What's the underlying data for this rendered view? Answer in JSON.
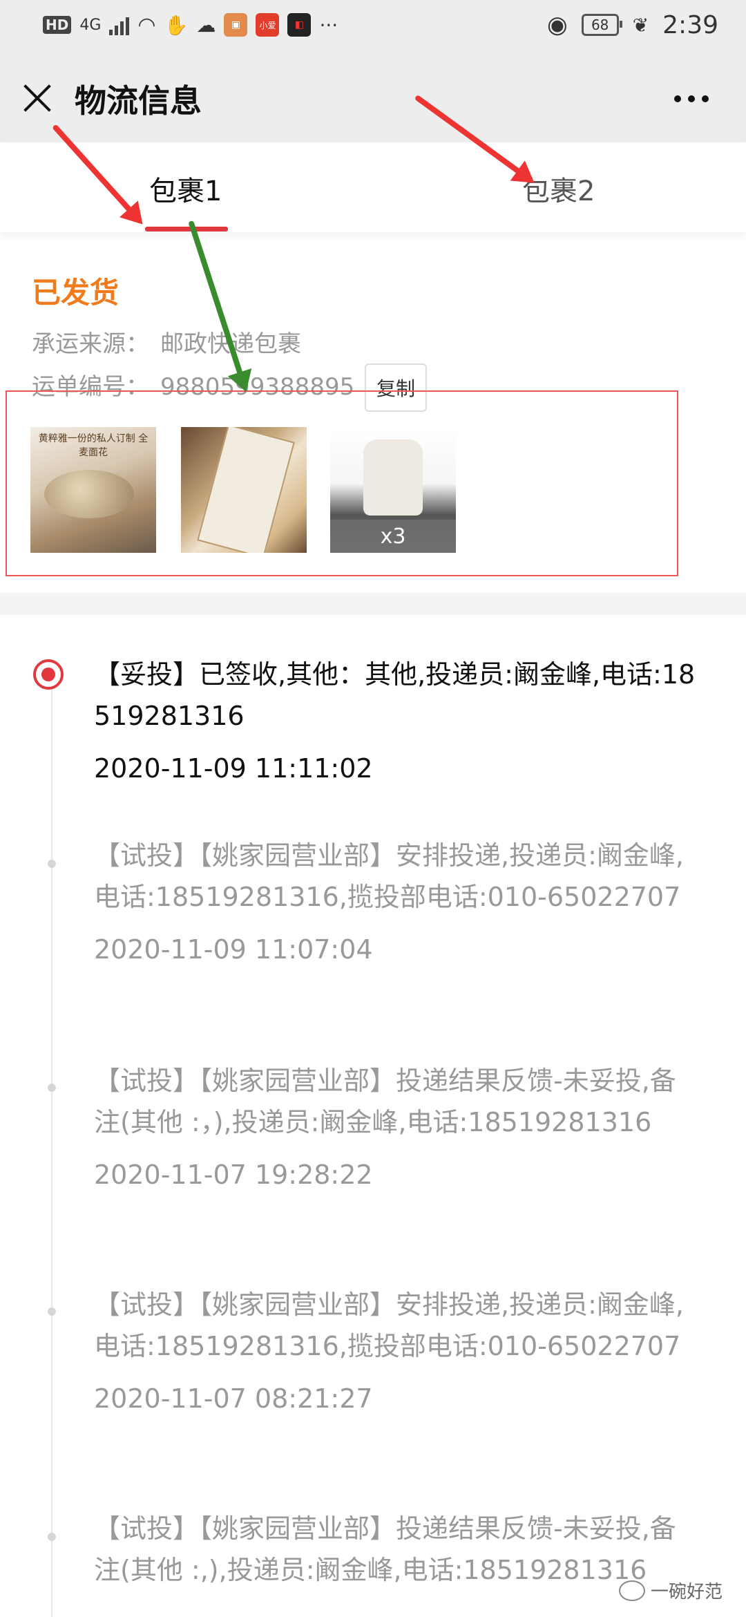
{
  "status_bar": {
    "hd": "HD",
    "network": "4G",
    "app_badge": "小爱",
    "more": "···",
    "battery": "68",
    "time": "2:39"
  },
  "header": {
    "title": "物流信息"
  },
  "tabs": [
    {
      "label": "包裹1",
      "active": true
    },
    {
      "label": "包裹2",
      "active": false
    }
  ],
  "shipment": {
    "status": "已发货",
    "carrier_label": "承运来源：",
    "carrier_value": "邮政快递包裹",
    "tracking_label": "运单编号：",
    "tracking_value": "9880599388895",
    "copy_label": "复制"
  },
  "products": [
    {
      "icon": "bread-product-image",
      "text": "黄粹雅一份的私人订制 全麦面花"
    },
    {
      "icon": "noodle-package-image"
    },
    {
      "icon": "flour-bag-image",
      "quantity": "x3"
    }
  ],
  "events": [
    {
      "desc": "【妥投】已签收,其他：其他,投递员:阚金峰,电话:18519281316",
      "time": "2020-11-09 11:11:02"
    },
    {
      "desc": "【试投】【姚家园营业部】安排投递,投递员:阚金峰,电话:18519281316,揽投部电话:010-65022707",
      "time": "2020-11-09 11:07:04"
    },
    {
      "desc": "【试投】【姚家园营业部】投递结果反馈-未妥投,备注(其他 :，),投递员:阚金峰,电话:18519281316",
      "time": "2020-11-07 19:28:22"
    },
    {
      "desc": "【试投】【姚家园营业部】安排投递,投递员:阚金峰,电话:18519281316,揽投部电话:010-65022707",
      "time": "2020-11-07 08:21:27"
    },
    {
      "desc": "【试投】【姚家园营业部】投递结果反馈-未妥投,备注(其他 :,),投递员:阚金峰,电话:18519281316",
      "time": ""
    }
  ],
  "watermark": "一碗好范",
  "colors": {
    "accent_red": "#e0383e",
    "status_orange": "#f07b1d",
    "annotation_red": "#ee3333",
    "annotation_green": "#3a8a2e"
  }
}
